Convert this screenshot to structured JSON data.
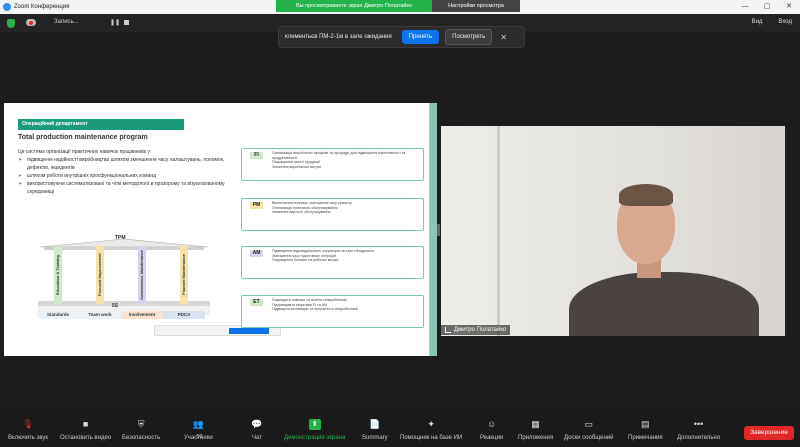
{
  "window": {
    "title": "Zoom Конференция",
    "share_banner": "Вы просматриваете экран Дмитро Полатайко",
    "view_settings": "Настройки просмотра",
    "controls": [
      "—",
      "▢",
      "✕"
    ]
  },
  "meeting_bar": {
    "recording_label": "Запись...",
    "pause_symbol": "❚❚",
    "right_items": [
      "Вид",
      "Вход"
    ]
  },
  "waiting_notice": {
    "text": "клементьєв ПМ-2-1м в зале ожидания",
    "admit": "Принять",
    "see": "Посмотреть",
    "close": "✕"
  },
  "slide": {
    "dept": "Операційний департамент",
    "title": "Total production maintenance program",
    "intro": "Це система організації практичних навичок працівників у:",
    "bullets": [
      "підвищенні надійності виробництва шляхом зменшення часу налаштувань, поломок, дефектів, інцидентів",
      "шляхом роботи внутрішніх кросфункціональних команд",
      "використовуючи систематизовані та чіткі методології в прозорому та візуалізованому середовищі"
    ],
    "house": {
      "top": "TPM",
      "pillars": [
        "Education & Training",
        "Focused Improvement",
        "Autonomous Maintenance",
        "Planned Maintenance"
      ],
      "foundation": "5S",
      "base": [
        "Standards",
        "Team work",
        "Involvement",
        "PDCA"
      ]
    },
    "cards": [
      {
        "tag": "FI",
        "color": "#cfe9c8",
        "items": [
          "Оптимізація виробничих процесів та процедур для підвищення ефективності та продуктивності",
          "Покращення якості продукції",
          "Зниження виробничих витрат"
        ]
      },
      {
        "tag": "PM",
        "color": "#f6e3a8",
        "items": [
          "Виключення поломок, зменшення часу ремонту",
          "Оптимізація планового обслуговування",
          "Зниження вартості обслуговування"
        ]
      },
      {
        "tag": "AM",
        "color": "#d9d0ec",
        "items": [
          "Підвищення відповідальності операторів за стан обладнання",
          "Зменшення часу підготовчих операцій",
          "Покращення безпеки на робочих місцях"
        ]
      },
      {
        "tag": "ET",
        "color": "#cfe9c8",
        "items": [
          "Покращити навички та знання співробітників",
          "Підтримувати ініціативи FI та AM",
          "Підвищити мотивацію та залученість співробітників"
        ]
      }
    ]
  },
  "video": {
    "participant_name": "Дмитро Полатайко"
  },
  "toolbar": {
    "items": [
      {
        "label": "Включить звук",
        "icon": "🎙",
        "name": "unmute"
      },
      {
        "label": "Остановить видео",
        "icon": "■",
        "name": "stop-video"
      },
      {
        "label": "Безопасность",
        "icon": "⛨",
        "name": "security"
      },
      {
        "label": "Участники",
        "icon": "👥",
        "name": "participants",
        "count": "50"
      },
      {
        "label": "Чат",
        "icon": "💬",
        "name": "chat"
      },
      {
        "label": "Демонстрация экрана",
        "icon": "⬆",
        "name": "share-screen"
      },
      {
        "label": "Summary",
        "icon": "📄",
        "name": "summary"
      },
      {
        "label": "Помощник на базе ИИ",
        "icon": "✦",
        "name": "ai-companion"
      },
      {
        "label": "Реакции",
        "icon": "☺",
        "name": "reactions"
      },
      {
        "label": "Приложения",
        "icon": "▦",
        "name": "apps"
      },
      {
        "label": "Доски сообщений",
        "icon": "▭",
        "name": "whiteboards"
      },
      {
        "label": "Примечания",
        "icon": "▤",
        "name": "notes"
      },
      {
        "label": "Дополнительно",
        "icon": "•••",
        "name": "more"
      }
    ],
    "end": "Завершение"
  }
}
